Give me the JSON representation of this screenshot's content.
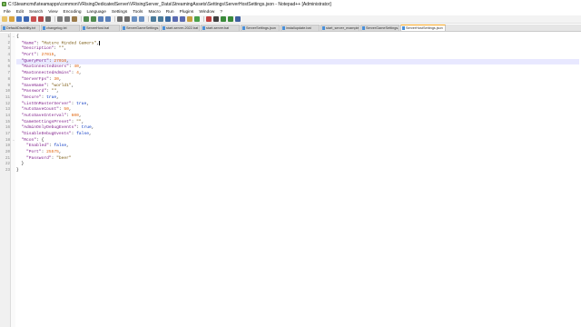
{
  "window": {
    "title": "C:\\Steamcmd\\steamapps\\common\\VRisingDedicatedServer\\VRisingServer_Data\\StreamingAssets\\Settings\\ServerHostSettings.json - Notepad++ [Administrator]"
  },
  "menu": [
    "File",
    "Edit",
    "Search",
    "View",
    "Encoding",
    "Language",
    "Settings",
    "Tools",
    "Macro",
    "Run",
    "Plugins",
    "Window",
    "?"
  ],
  "tabs": [
    {
      "label": "DefaultDisability.txt",
      "active": false
    },
    {
      "label": "changelog.txt",
      "active": false
    },
    {
      "label": "ServerHost.bat",
      "active": false
    },
    {
      "label": "ServerGameSettings.json",
      "active": false
    },
    {
      "label": "start-server-2022.bat",
      "active": false
    },
    {
      "label": "start-server.bat",
      "active": false
    },
    {
      "label": "ServerSettings.json",
      "active": false
    },
    {
      "label": "installupdate.bat",
      "active": false
    },
    {
      "label": "start_server_example.bat",
      "active": false
    },
    {
      "label": "ServerGameSettings.json",
      "active": false
    },
    {
      "label": "ServerHostSettings.json",
      "active": true
    }
  ],
  "editor": {
    "current_line": 4,
    "lines": [
      {
        "no": "1",
        "fold": "-",
        "parts": [
          {
            "t": "{",
            "c": "p"
          }
        ]
      },
      {
        "no": "2",
        "fold": "",
        "parts": [
          {
            "t": "  \"Name\"",
            "c": "k"
          },
          {
            "t": ": ",
            "c": "p"
          },
          {
            "t": "\"Mature Minded Gamers\"",
            "c": "s"
          },
          {
            "t": ",",
            "c": "p"
          }
        ]
      },
      {
        "no": "3",
        "fold": "",
        "parts": [
          {
            "t": "  \"Description\"",
            "c": "k"
          },
          {
            "t": ": ",
            "c": "p"
          },
          {
            "t": "\"\"",
            "c": "s"
          },
          {
            "t": ",",
            "c": "p"
          }
        ]
      },
      {
        "no": "4",
        "fold": "",
        "parts": [
          {
            "t": "  \"Port\"",
            "c": "k"
          },
          {
            "t": ": ",
            "c": "p"
          },
          {
            "t": "27015",
            "c": "n"
          },
          {
            "t": ",",
            "c": "p"
          }
        ]
      },
      {
        "no": "5",
        "fold": "",
        "parts": [
          {
            "t": "  \"QueryPort\"",
            "c": "k"
          },
          {
            "t": ": ",
            "c": "p"
          },
          {
            "t": "27016",
            "c": "n"
          },
          {
            "t": ",",
            "c": "p"
          }
        ]
      },
      {
        "no": "6",
        "fold": "",
        "parts": [
          {
            "t": "  \"MaxConnectedUsers\"",
            "c": "k"
          },
          {
            "t": ": ",
            "c": "p"
          },
          {
            "t": "40",
            "c": "n"
          },
          {
            "t": ",",
            "c": "p"
          }
        ]
      },
      {
        "no": "7",
        "fold": "",
        "parts": [
          {
            "t": "  \"MaxConnectedAdmins\"",
            "c": "k"
          },
          {
            "t": ": ",
            "c": "p"
          },
          {
            "t": "4",
            "c": "n"
          },
          {
            "t": ",",
            "c": "p"
          }
        ]
      },
      {
        "no": "8",
        "fold": "",
        "parts": [
          {
            "t": "  \"ServerFps\"",
            "c": "k"
          },
          {
            "t": ": ",
            "c": "p"
          },
          {
            "t": "30",
            "c": "n"
          },
          {
            "t": ",",
            "c": "p"
          }
        ]
      },
      {
        "no": "9",
        "fold": "",
        "parts": [
          {
            "t": "  \"SaveName\"",
            "c": "k"
          },
          {
            "t": ": ",
            "c": "p"
          },
          {
            "t": "\"world1\"",
            "c": "s"
          },
          {
            "t": ",",
            "c": "p"
          }
        ]
      },
      {
        "no": "10",
        "fold": "",
        "parts": [
          {
            "t": "  \"Password\"",
            "c": "k"
          },
          {
            "t": ": ",
            "c": "p"
          },
          {
            "t": "\"\"",
            "c": "s"
          },
          {
            "t": ",",
            "c": "p"
          }
        ]
      },
      {
        "no": "11",
        "fold": "",
        "parts": [
          {
            "t": "  \"Secure\"",
            "c": "k"
          },
          {
            "t": ": ",
            "c": "p"
          },
          {
            "t": "true",
            "c": "b"
          },
          {
            "t": ",",
            "c": "p"
          }
        ]
      },
      {
        "no": "12",
        "fold": "",
        "parts": [
          {
            "t": "  \"ListOnMasterServer\"",
            "c": "k"
          },
          {
            "t": ": ",
            "c": "p"
          },
          {
            "t": "true",
            "c": "b"
          },
          {
            "t": ",",
            "c": "p"
          }
        ]
      },
      {
        "no": "13",
        "fold": "",
        "parts": [
          {
            "t": "  \"AutoSaveCount\"",
            "c": "k"
          },
          {
            "t": ": ",
            "c": "p"
          },
          {
            "t": "50",
            "c": "n"
          },
          {
            "t": ",",
            "c": "p"
          }
        ]
      },
      {
        "no": "14",
        "fold": "",
        "parts": [
          {
            "t": "  \"AutoSaveInterval\"",
            "c": "k"
          },
          {
            "t": ": ",
            "c": "p"
          },
          {
            "t": "600",
            "c": "n"
          },
          {
            "t": ",",
            "c": "p"
          }
        ]
      },
      {
        "no": "15",
        "fold": "",
        "parts": [
          {
            "t": "  \"GameSettingsPreset\"",
            "c": "k"
          },
          {
            "t": ": ",
            "c": "p"
          },
          {
            "t": "\"\"",
            "c": "s"
          },
          {
            "t": ",",
            "c": "p"
          }
        ]
      },
      {
        "no": "16",
        "fold": "",
        "parts": [
          {
            "t": "  \"AdminOnlyDebugEvents\"",
            "c": "k"
          },
          {
            "t": ": ",
            "c": "p"
          },
          {
            "t": "true",
            "c": "b"
          },
          {
            "t": ",",
            "c": "p"
          }
        ]
      },
      {
        "no": "17",
        "fold": "",
        "parts": [
          {
            "t": "  \"DisableDebugEvents\"",
            "c": "k"
          },
          {
            "t": ": ",
            "c": "p"
          },
          {
            "t": "false",
            "c": "b"
          },
          {
            "t": ",",
            "c": "p"
          }
        ]
      },
      {
        "no": "18",
        "fold": "-",
        "parts": [
          {
            "t": "  \"Rcon\"",
            "c": "k"
          },
          {
            "t": ": {",
            "c": "p"
          }
        ]
      },
      {
        "no": "19",
        "fold": "",
        "parts": [
          {
            "t": "    \"Enabled\"",
            "c": "k"
          },
          {
            "t": ": ",
            "c": "p"
          },
          {
            "t": "false",
            "c": "b"
          },
          {
            "t": ",",
            "c": "p"
          }
        ]
      },
      {
        "no": "20",
        "fold": "",
        "parts": [
          {
            "t": "    \"Port\"",
            "c": "k"
          },
          {
            "t": ": ",
            "c": "p"
          },
          {
            "t": "25575",
            "c": "n"
          },
          {
            "t": ",",
            "c": "p"
          }
        ]
      },
      {
        "no": "21",
        "fold": "",
        "parts": [
          {
            "t": "    \"Password\"",
            "c": "k"
          },
          {
            "t": ": ",
            "c": "p"
          },
          {
            "t": "\"beer\"",
            "c": "s"
          }
        ]
      },
      {
        "no": "22",
        "fold": "",
        "parts": [
          {
            "t": "  }",
            "c": "p"
          }
        ]
      },
      {
        "no": "23",
        "fold": "",
        "parts": [
          {
            "t": "}",
            "c": "p"
          }
        ]
      }
    ]
  },
  "toolbar_icons": [
    "new-file-icon",
    "open-file-icon",
    "save-icon",
    "save-all-icon",
    "close-icon",
    "close-all-icon",
    "print-icon",
    "cut-icon",
    "copy-icon",
    "paste-icon",
    "undo-icon",
    "redo-icon",
    "find-icon",
    "replace-icon",
    "zoom-in-icon",
    "zoom-out-icon",
    "sync-v-icon",
    "sync-h-icon",
    "word-wrap-icon",
    "show-all-chars-icon",
    "indent-guide-icon",
    "doc-map-icon",
    "function-list-icon",
    "folder-workspace-icon",
    "monitoring-icon",
    "record-macro-icon",
    "stop-macro-icon",
    "play-macro-icon",
    "run-macro-multiple-icon",
    "save-macro-icon"
  ],
  "colors": {
    "accent_tab": "#f5a623",
    "key": "#7f1d8a",
    "string": "#7a5a12",
    "number": "#e0620a",
    "bool": "#0030c0",
    "current_line": "#e8e8ff"
  }
}
